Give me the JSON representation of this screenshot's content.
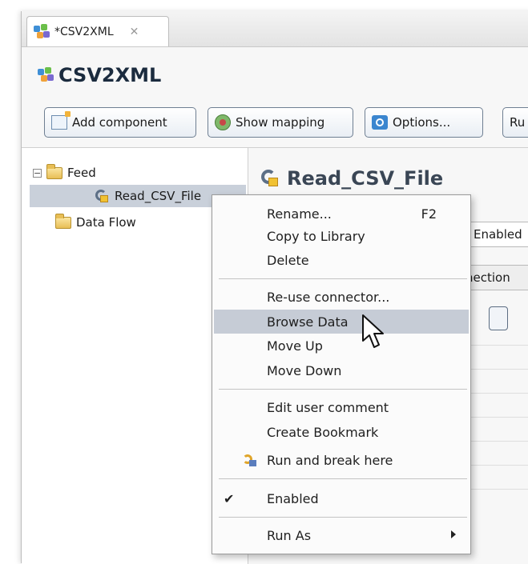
{
  "tab": {
    "title": "*CSV2XML",
    "close_glyph": "✕",
    "icon": "component-cube-icon"
  },
  "editor": {
    "title": "CSV2XML"
  },
  "toolbar": {
    "add_component": "Add component",
    "show_mapping": "Show mapping",
    "options": "Options...",
    "run_fragment": "Ru"
  },
  "tree": {
    "feed": {
      "label": "Feed",
      "expander": "−"
    },
    "read_csv": {
      "label": "Read_CSV_File"
    },
    "data_flow": {
      "label": "Data Flow"
    }
  },
  "detail": {
    "title": "Read_CSV_File",
    "enabled_fragment": "Enabled",
    "section_fragment": "nection"
  },
  "context_menu": {
    "items": [
      {
        "label": "Rename...",
        "accelerator": "F2"
      },
      {
        "label": "Copy to Library"
      },
      {
        "label": "Delete"
      },
      {
        "label": "Re-use connector..."
      },
      {
        "label": "Browse Data",
        "highlighted": true
      },
      {
        "label": "Move Up"
      },
      {
        "label": "Move Down"
      },
      {
        "label": "Edit user comment"
      },
      {
        "label": "Create Bookmark"
      },
      {
        "label": "Run and break here"
      },
      {
        "label": "Enabled",
        "checked": "✔"
      },
      {
        "label": "Run As"
      }
    ]
  },
  "colors": {
    "selection": "#c9d0da",
    "menu_highlight": "#c6ccd6",
    "title_text": "#1b2b3e"
  }
}
